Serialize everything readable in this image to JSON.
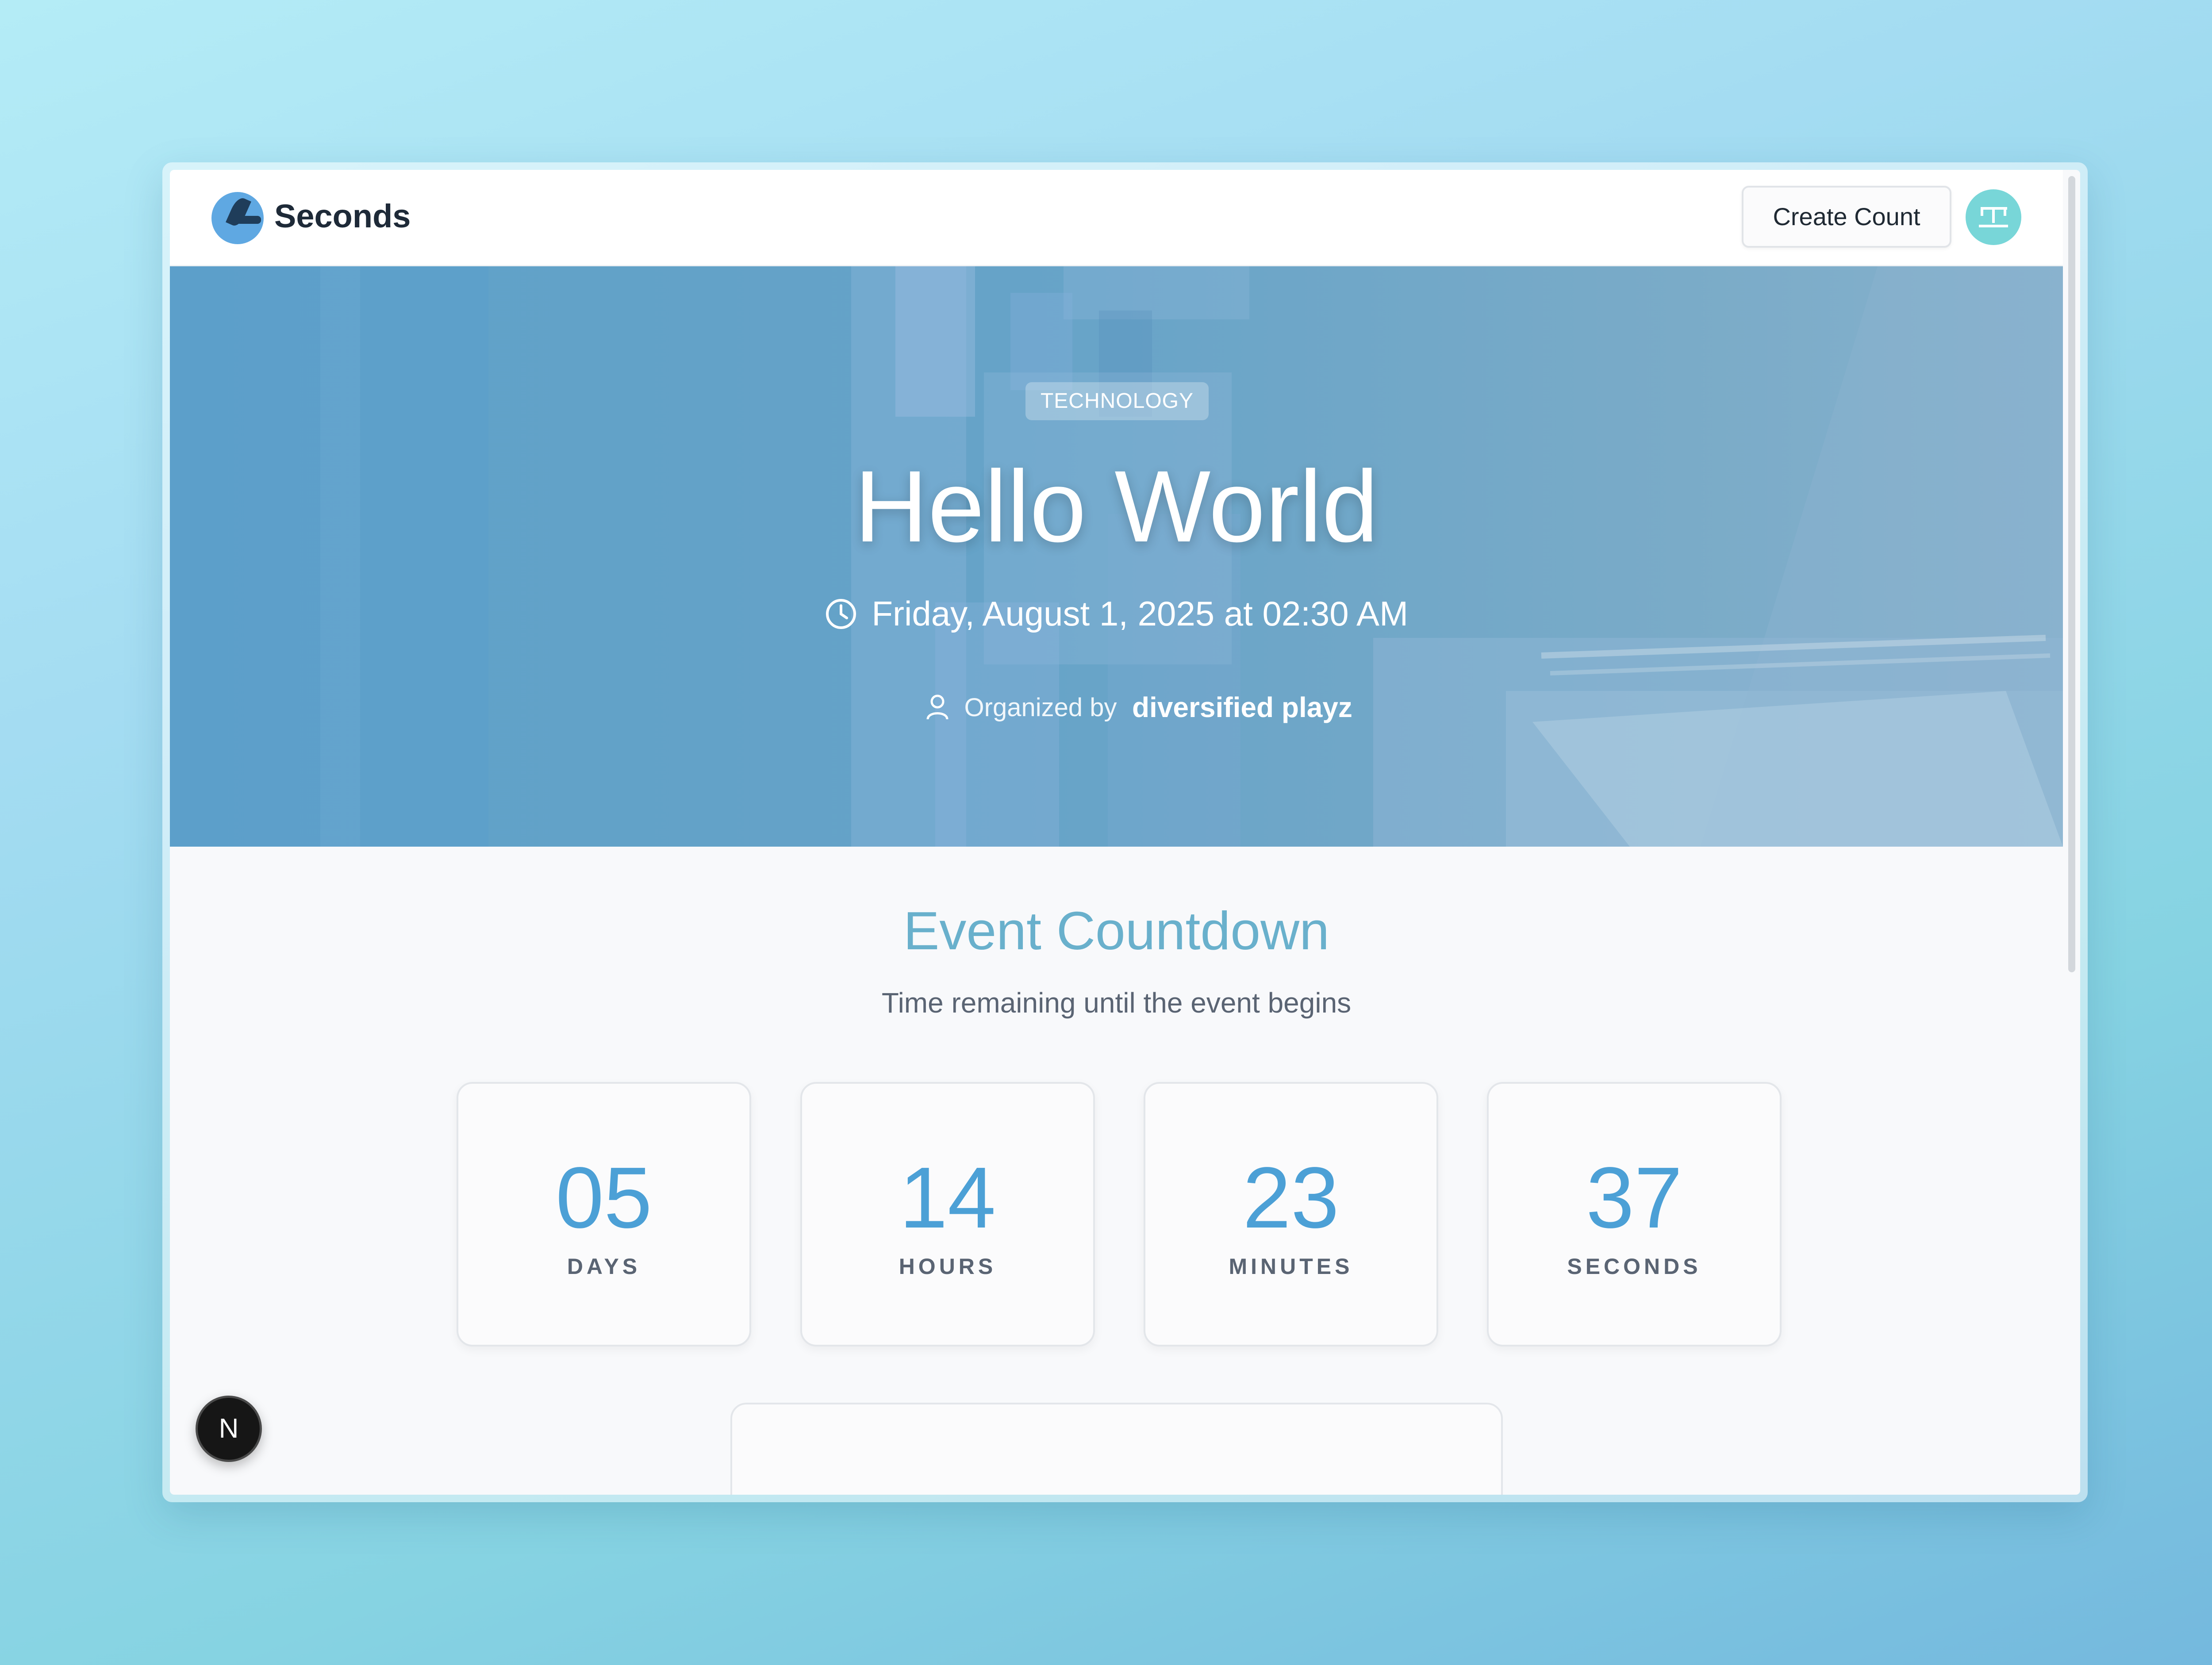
{
  "header": {
    "brand": "Seconds",
    "create_label": "Create Count",
    "logo_icon": "moon-logo-icon",
    "avatar_icon": "avatar-face-icon"
  },
  "hero": {
    "category": "TECHNOLOGY",
    "title": "Hello World",
    "datetime": "Friday, August 1, 2025 at 02:30 AM",
    "organized_label": "Organized by",
    "organizer": "diversified playz",
    "clock_icon": "clock-icon",
    "person_icon": "person-icon"
  },
  "countdown": {
    "title": "Event Countdown",
    "subtitle": "Time remaining until the event begins",
    "units": [
      {
        "value": "05",
        "label": "DAYS"
      },
      {
        "value": "14",
        "label": "HOURS"
      },
      {
        "value": "23",
        "label": "MINUTES"
      },
      {
        "value": "37",
        "label": "SECONDS"
      }
    ]
  },
  "dev_badge": {
    "label": "N",
    "icon": "nextjs-icon"
  },
  "colors": {
    "accent": "#4ca0d6",
    "section_title": "#69b0cc",
    "hero": "#66a3c8"
  }
}
